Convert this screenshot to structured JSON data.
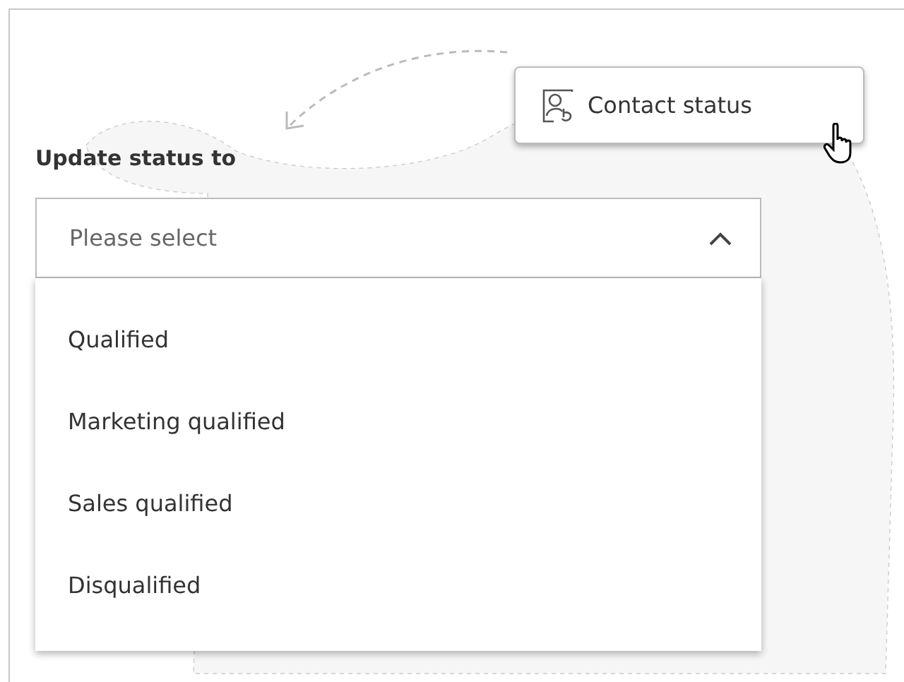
{
  "tooltip": {
    "label": "Contact status"
  },
  "field": {
    "label": "Update status to",
    "placeholder": "Please select",
    "expanded": true
  },
  "options": [
    {
      "label": "Qualified",
      "selected": false
    },
    {
      "label": "Marketing qualified",
      "selected": false
    },
    {
      "label": "Sales qualified",
      "selected": false
    },
    {
      "label": "Disqualified",
      "selected": false
    }
  ]
}
